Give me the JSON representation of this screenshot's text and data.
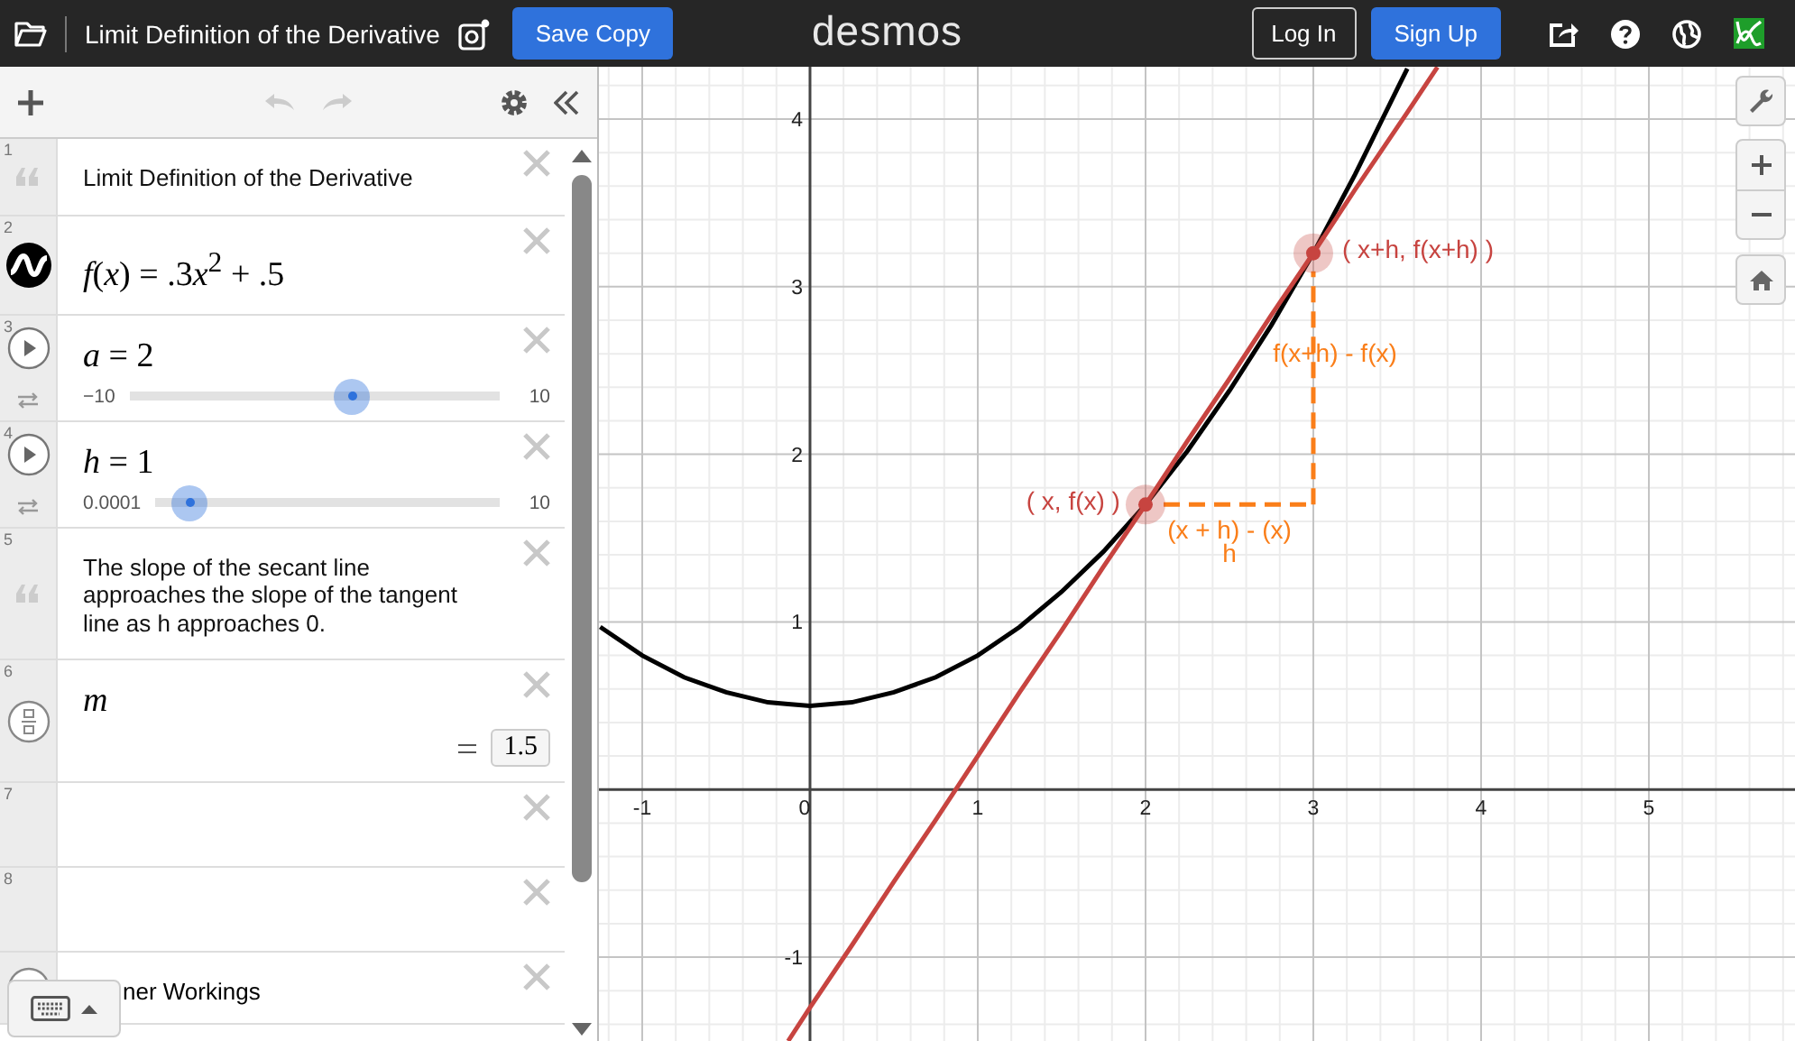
{
  "topbar": {
    "title": "Limit Definition of the Derivative",
    "save_button": "Save Copy",
    "logo": "desmos",
    "login_button": "Log In",
    "signup_button": "Sign Up"
  },
  "expressions": [
    {
      "kind": "note",
      "number": "1",
      "text": "Limit Definition of the Derivative"
    },
    {
      "kind": "expression",
      "number": "2",
      "latex": "f(x) = .3x$^{2}$ + .5"
    },
    {
      "kind": "slider",
      "number": "3",
      "latex": "a = 2",
      "min": "−10",
      "max": "10",
      "level": 0.6
    },
    {
      "kind": "slider",
      "number": "4",
      "latex": "h = 1",
      "min": "0.0001",
      "max": "10",
      "level": 0.1
    },
    {
      "kind": "note",
      "number": "5",
      "text": "The slope of the secant line approaches the slope of the tangent line as h approaches 0."
    },
    {
      "kind": "value",
      "number": "6",
      "latex": "m",
      "result": "1.5"
    },
    {
      "kind": "empty",
      "number": "7"
    },
    {
      "kind": "empty",
      "number": "8"
    },
    {
      "kind": "folder",
      "text": "ner Workings"
    }
  ],
  "graph": {
    "chart_data": {
      "type": "line",
      "x": [
        -1.25,
        -1,
        -0.75,
        -0.5,
        -0.25,
        -0.13,
        0,
        0.25,
        0.5,
        0.75,
        1,
        1.25,
        1.5,
        1.75,
        2,
        2.25,
        2.5,
        2.75,
        3,
        3.25,
        3.5,
        3.56,
        3.74
      ],
      "series": [
        {
          "color": "#000000",
          "values": [
            0.97,
            0.8,
            0.67,
            0.58,
            0.52,
            0.51,
            0.5,
            0.52,
            0.58,
            0.67,
            0.8,
            0.97,
            1.18,
            1.42,
            1.7,
            2.02,
            2.38,
            2.77,
            3.2,
            3.67,
            4.18,
            4.3,
            null
          ]
        },
        {
          "color": "#c74440",
          "values": [
            null,
            null,
            null,
            null,
            null,
            -1.5,
            -1.3,
            -0.93,
            -0.55,
            -0.18,
            0.2,
            0.58,
            0.95,
            1.33,
            1.7,
            2.08,
            2.45,
            2.83,
            3.2,
            3.58,
            3.95,
            4.04,
            4.31
          ]
        }
      ],
      "grid": true,
      "xlim": [
        -1.258,
        5.871
      ],
      "ylim": [
        -1.5,
        4.312
      ],
      "xticks": [
        {
          "value": -1,
          "label": "-1"
        },
        {
          "value": 0,
          "label": "0"
        },
        {
          "value": 1,
          "label": "1"
        },
        {
          "value": 2,
          "label": "2"
        },
        {
          "value": 3,
          "label": "3"
        },
        {
          "value": 4,
          "label": "4"
        },
        {
          "value": 5,
          "label": "5"
        }
      ],
      "yticks": [
        {
          "value": -1,
          "label": "-1"
        },
        {
          "value": 1,
          "label": "1"
        },
        {
          "value": 2,
          "label": "2"
        },
        {
          "value": 3,
          "label": "3"
        },
        {
          "value": 4,
          "label": "4"
        }
      ],
      "annotations": [
        {
          "x": 2,
          "y": 1.7,
          "text": "( x, f(x) )"
        },
        {
          "x": 3,
          "y": 3.2,
          "text": "( x+h, f(x+h) )"
        },
        "f(x+h) - f(x)",
        "(x + h) - (x)",
        "h"
      ]
    }
  }
}
